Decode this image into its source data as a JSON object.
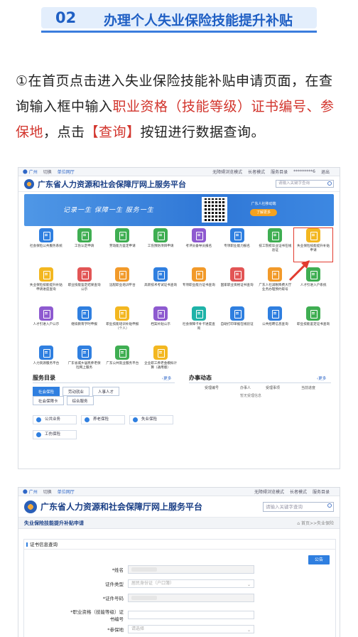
{
  "section": {
    "number": "02",
    "title": "办理个人失业保险技能提升补贴"
  },
  "instruction": {
    "part1": "①在首页点击进入失业保险技能补贴申请页面，在查询输入框中输入",
    "red1": "职业资格（技能等级）证书编号、参保地",
    "part2": "，点击",
    "red2": "【查询】",
    "part3": "按钮进行数据查询。"
  },
  "portal": {
    "topbar": {
      "city": "广州",
      "switch": "切换",
      "unit_hall": "单位网厅",
      "accessibility": "无障碍浏览模式",
      "elder_mode": "长者模式",
      "service_dir": "服务目录",
      "user": "*********6",
      "logout": "退出"
    },
    "site_title": "广东省人力资源和社会保障厅网上服务平台",
    "search_placeholder": "请输入关键字查询",
    "banner": {
      "slogan": "记录一生  保障一生  服务一生",
      "cta_text": "广东人社移动端",
      "cta_button": "了解更多"
    },
    "tiles": [
      {
        "label": "社会保险公共服务系统",
        "color": "#2f7fe0"
      },
      {
        "label": "工伤认定申请",
        "color": "#3fae52"
      },
      {
        "label": "劳动能力鉴定申请",
        "color": "#3fae52"
      },
      {
        "label": "工伤预防项目申请",
        "color": "#3fae52"
      },
      {
        "label": "考评员备导员报名",
        "color": "#8e5ad0"
      },
      {
        "label": "专项职业能力报名",
        "color": "#2f7fe0"
      },
      {
        "label": "技工院校毕业证书在线验证",
        "color": "#3fae52"
      },
      {
        "label": "失业保险技能提升补贴申请",
        "color": "#f3b720"
      },
      {
        "label": "失业保险技能提升补贴申请进度查询",
        "color": "#f3b720"
      },
      {
        "label": "职业技能鉴定结果查询公示",
        "color": "#e25555"
      },
      {
        "label": "远程职业培训平台",
        "color": "#f29a2a"
      },
      {
        "label": "高新技术考试证书查询",
        "color": "#2f7fe0"
      },
      {
        "label": "专项职业能力证书查询",
        "color": "#f29a2a"
      },
      {
        "label": "国家职业资格证书查询",
        "color": "#e25555"
      },
      {
        "label": "广东人社减税降费大厅业务办理预约取号",
        "color": "#f29a2a"
      },
      {
        "label": "人才引进入户系统",
        "color": "#3fae52"
      },
      {
        "label": "人才引进入户公示",
        "color": "#8e5ad0"
      },
      {
        "label": "继续教育学时申报",
        "color": "#2f7fe0"
      },
      {
        "label": "职业技能培训补贴申报（个人）",
        "color": "#f3b720"
      },
      {
        "label": "档案补贴公示",
        "color": "#8e5ad0"
      },
      {
        "label": "社会保障卡补卡进度查询",
        "color": "#1eb3a8"
      },
      {
        "label": "自助打印单据在线验证",
        "color": "#2f7fe0"
      },
      {
        "label": "公共招聘信息查询",
        "color": "#2f7fe0"
      },
      {
        "label": "职业技能鉴定证书查询",
        "color": "#3fae52"
      },
      {
        "label": "人力资源服务平台",
        "color": "#2f7fe0"
      },
      {
        "label": "广东省城乡居民养老保险网上服务",
        "color": "#2f7fe0"
      },
      {
        "label": "广东公共就业服务平台",
        "color": "#3fae52"
      },
      {
        "label": "企业职工养老金模拟计算（通用版）",
        "color": "#f3b720"
      }
    ],
    "service_dir": {
      "title": "服务目录",
      "more": "更多",
      "categories": [
        "社会保险",
        "劳动就业",
        "人事人才",
        "社会保障卡",
        "综合服务"
      ],
      "items": [
        "公共业务",
        "养老保险",
        "失业保险",
        "工伤保险"
      ]
    },
    "news": {
      "title": "办事动态",
      "more": "更多",
      "columns": [
        "受理编号",
        "办事人",
        "受理事项",
        "当前进度"
      ],
      "empty": "暂无受理信息"
    }
  },
  "form_page": {
    "topbar": {
      "city": "广州",
      "switch": "切换",
      "unit_hall": "单位网厅",
      "accessibility": "无障碍浏览模式",
      "elder_mode": "长者模式",
      "service_dir": "服务目录"
    },
    "site_title": "广东省人力资源和社会保障厅网上服务平台",
    "search_placeholder": "请输入关键字查询",
    "page_title": "失业保险技能提升补贴申请",
    "breadcrumb": "首页>>失业保险",
    "card_title": "证书信息查询",
    "notice_button": "公告",
    "fields": [
      {
        "label": "*姓名",
        "value": "",
        "dim": true
      },
      {
        "label": "证件类型",
        "value": "居民身份证（户口簿）",
        "select": true
      },
      {
        "label": "*证件号码",
        "value": "",
        "dim": true
      },
      {
        "label": "*职业资格（技能等级）证书编号",
        "value": ""
      },
      {
        "label": "*参保地",
        "value": "请选择",
        "select": true
      }
    ]
  },
  "colors": {
    "accent": "#1f5fc4",
    "red": "#d2342c",
    "portal_blue": "#2f7fe0"
  }
}
